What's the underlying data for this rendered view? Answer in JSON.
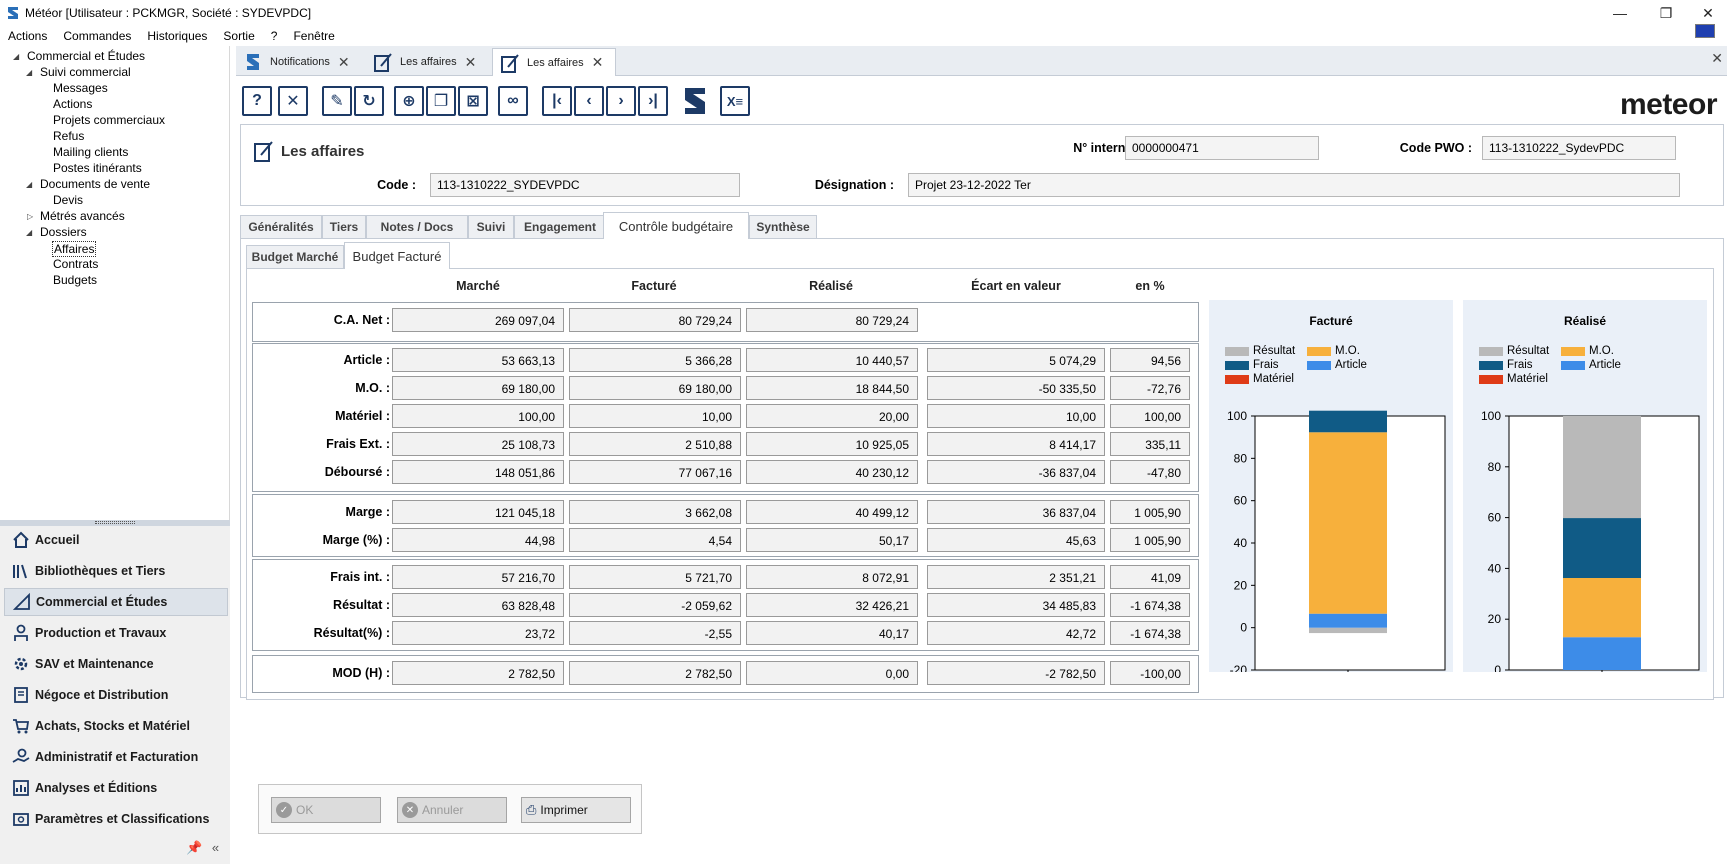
{
  "window": {
    "title": "Météor [Utilisateur : PCKMGR, Société : SYDEVPDC]"
  },
  "menu": [
    "Actions",
    "Commandes",
    "Historiques",
    "Sortie",
    "?",
    "Fenêtre"
  ],
  "tree": [
    {
      "label": "Commercial et Études",
      "level": 0,
      "expanded": true
    },
    {
      "label": "Suivi commercial",
      "level": 1,
      "expanded": true
    },
    {
      "label": "Messages",
      "level": 2
    },
    {
      "label": "Actions",
      "level": 2
    },
    {
      "label": "Projets commerciaux",
      "level": 2
    },
    {
      "label": "Refus",
      "level": 2
    },
    {
      "label": "Mailing clients",
      "level": 2
    },
    {
      "label": "Postes itinérants",
      "level": 2
    },
    {
      "label": "Documents de vente",
      "level": 1,
      "expanded": true
    },
    {
      "label": "Devis",
      "level": 2
    },
    {
      "label": "Métrés avancés",
      "level": 1,
      "expanded": false
    },
    {
      "label": "Dossiers",
      "level": 1,
      "expanded": true
    },
    {
      "label": "Affaires",
      "level": 2,
      "selected": true
    },
    {
      "label": "Contrats",
      "level": 2
    },
    {
      "label": "Budgets",
      "level": 2
    }
  ],
  "nav": [
    {
      "label": "Accueil",
      "icon": "home-icon"
    },
    {
      "label": "Bibliothèques et Tiers",
      "icon": "books-icon"
    },
    {
      "label": "Commercial et Études",
      "icon": "ruler-icon",
      "active": true
    },
    {
      "label": "Production et Travaux",
      "icon": "worker-icon"
    },
    {
      "label": "SAV et Maintenance",
      "icon": "gear-icon"
    },
    {
      "label": "Négoce et Distribution",
      "icon": "document-icon"
    },
    {
      "label": "Achats, Stocks et Matériel",
      "icon": "cart-icon"
    },
    {
      "label": "Administratif et Facturation",
      "icon": "hand-coin-icon"
    },
    {
      "label": "Analyses et Éditions",
      "icon": "chart-icon"
    },
    {
      "label": "Paramètres et Classifications",
      "icon": "settings-icon"
    }
  ],
  "doctabs": [
    {
      "label": "Notifications",
      "active": false
    },
    {
      "label": "Les affaires",
      "active": false
    },
    {
      "label": "Les affaires",
      "active": true
    }
  ],
  "toolbar": {
    "buttons": [
      "help-icon",
      "close-icon",
      "edit-icon",
      "refresh-icon",
      "add-icon",
      "duplicate-icon",
      "delete-icon",
      "search-icon",
      "first-icon",
      "previous-icon",
      "next-icon",
      "last-icon",
      "meteor-icon",
      "excel-icon"
    ],
    "logo": "meteor"
  },
  "header": {
    "title": "Les affaires",
    "num_interne_label": "N° interne :",
    "num_interne": "0000000471",
    "code_pwo_label": "Code PWO :",
    "code_pwo": "113-1310222_SydevPDC",
    "code_label": "Code :",
    "code": "113-1310222_SYDEVPDC",
    "designation_label": "Désignation :",
    "designation": "Projet 23-12-2022 Ter"
  },
  "tabs": [
    "Généralités",
    "Tiers",
    "Notes / Docs",
    "Suivi",
    "Engagement",
    "Contrôle budgétaire",
    "Synthèse"
  ],
  "active_tab": "Contrôle budgétaire",
  "subtabs": [
    "Budget Marché",
    "Budget Facturé"
  ],
  "active_subtab": "Budget Facturé",
  "grid": {
    "columns": [
      "Marché",
      "Facturé",
      "Réalisé",
      "Écart en valeur",
      "en %"
    ],
    "rows": [
      {
        "label": "C.A. Net :",
        "values": [
          "269 097,04",
          "80 729,24",
          "80 729,24"
        ]
      },
      {
        "label": "Article :",
        "values": [
          "53 663,13",
          "5 366,28",
          "10 440,57",
          "5 074,29",
          "94,56"
        ]
      },
      {
        "label": "M.O. :",
        "values": [
          "69 180,00",
          "69 180,00",
          "18 844,50",
          "-50 335,50",
          "-72,76"
        ]
      },
      {
        "label": "Matériel :",
        "values": [
          "100,00",
          "10,00",
          "20,00",
          "10,00",
          "100,00"
        ]
      },
      {
        "label": "Frais Ext. :",
        "values": [
          "25 108,73",
          "2 510,88",
          "10 925,05",
          "8 414,17",
          "335,11"
        ]
      },
      {
        "label": "Déboursé :",
        "values": [
          "148 051,86",
          "77 067,16",
          "40 230,12",
          "-36 837,04",
          "-47,80"
        ]
      },
      {
        "label": "Marge :",
        "values": [
          "121 045,18",
          "3 662,08",
          "40 499,12",
          "36 837,04",
          "1 005,90"
        ]
      },
      {
        "label": "Marge (%) :",
        "values": [
          "44,98",
          "4,54",
          "50,17",
          "45,63",
          "1 005,90"
        ]
      },
      {
        "label": "Frais int. :",
        "values": [
          "57 216,70",
          "5 721,70",
          "8 072,91",
          "2 351,21",
          "41,09"
        ]
      },
      {
        "label": "Résultat :",
        "values": [
          "63 828,48",
          "-2 059,62",
          "32 426,21",
          "34 485,83",
          "-1 674,38"
        ]
      },
      {
        "label": "Résultat(%) :",
        "values": [
          "23,72",
          "-2,55",
          "40,17",
          "42,72",
          "-1 674,38"
        ]
      },
      {
        "label": "MOD (H) :",
        "values": [
          "2 782,50",
          "2 782,50",
          "0,00",
          "-2 782,50",
          "-100,00"
        ]
      }
    ]
  },
  "colors": {
    "resultat": "#b9b9b9",
    "mo": "#f7b03c",
    "frais": "#105b86",
    "article": "#3d8ce8",
    "materiel": "#df3b17"
  },
  "chart_data": [
    {
      "type": "bar",
      "title": "Facturé",
      "legend": [
        "Résultat",
        "M.O.",
        "Frais",
        "Article",
        "Matériel"
      ],
      "ylim": [
        -20,
        100
      ],
      "yticks": [
        "100",
        "80",
        "60",
        "40",
        "20",
        "0",
        "-20"
      ],
      "series": [
        {
          "name": "Résultat",
          "value": -2.55
        },
        {
          "name": "Article",
          "value": 6.6
        },
        {
          "name": "Matériel",
          "value": 0.01
        },
        {
          "name": "M.O.",
          "value": 85.7
        },
        {
          "name": "Frais",
          "value": 10.2
        }
      ]
    },
    {
      "type": "bar",
      "title": "Réalisé",
      "legend": [
        "Résultat",
        "M.O.",
        "Frais",
        "Article",
        "Matériel"
      ],
      "ylim": [
        0,
        100
      ],
      "yticks": [
        "100",
        "80",
        "60",
        "40",
        "20",
        "0"
      ],
      "series": [
        {
          "name": "Article",
          "value": 12.9
        },
        {
          "name": "Matériel",
          "value": 0.02
        },
        {
          "name": "M.O.",
          "value": 23.3
        },
        {
          "name": "Frais",
          "value": 23.6
        },
        {
          "name": "Résultat",
          "value": 40.2
        }
      ]
    }
  ],
  "buttons": {
    "ok": "OK",
    "annuler": "Annuler",
    "imprimer": "Imprimer"
  }
}
